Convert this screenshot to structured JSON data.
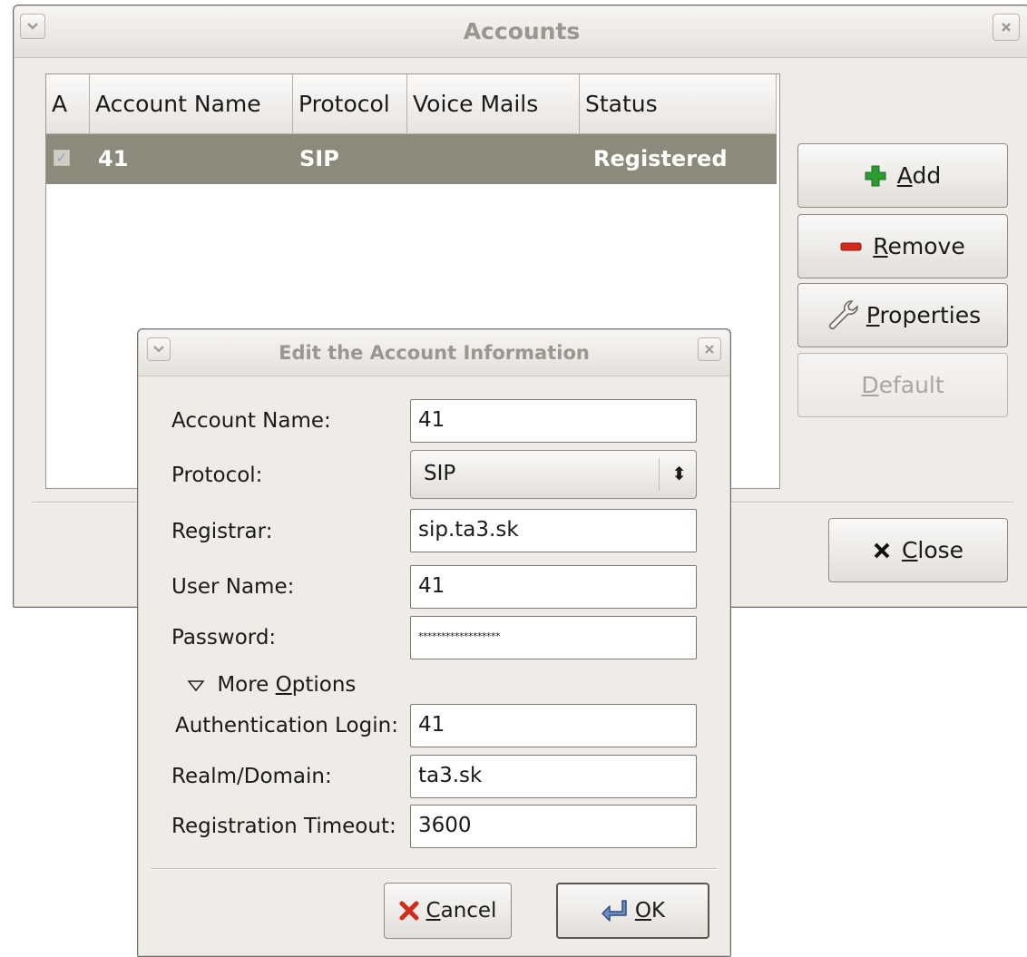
{
  "accounts_window": {
    "title": "Accounts",
    "columns": [
      "A",
      "Account Name",
      "Protocol",
      "Voice Mails",
      "Status"
    ],
    "rows": [
      {
        "active": true,
        "account_name": "41",
        "protocol": "SIP",
        "voice_mails": "",
        "status": "Registered"
      }
    ],
    "buttons": {
      "add": "Add",
      "remove": "Remove",
      "properties": "Properties",
      "default": "Default",
      "close": "Close"
    }
  },
  "edit_dialog": {
    "title": "Edit the Account Information",
    "labels": {
      "account_name": "Account Name:",
      "protocol": "Protocol:",
      "registrar": "Registrar:",
      "user_name": "User Name:",
      "password": "Password:",
      "auth_login": "Authentication Login:",
      "realm": "Realm/Domain:",
      "reg_timeout": "Registration Timeout:"
    },
    "values": {
      "account_name": "41",
      "protocol": "SIP",
      "registrar": "sip.ta3.sk",
      "user_name": "41",
      "password": "******************",
      "auth_login": "41",
      "realm": "ta3.sk",
      "reg_timeout": "3600"
    },
    "more_options": "More Options",
    "buttons": {
      "cancel": "Cancel",
      "ok": "OK"
    }
  },
  "colors": {
    "selected_row": "#8c8b7b",
    "window_bg": "#efebe7",
    "add_icon": "#2e9b32",
    "remove_icon": "#d42a1a"
  }
}
